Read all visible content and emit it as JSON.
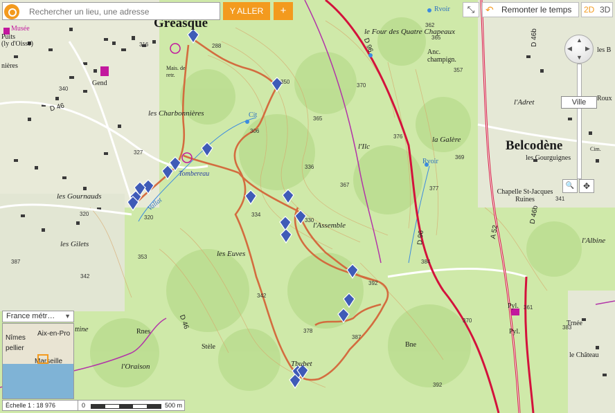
{
  "search": {
    "placeholder": "Rechercher un lieu, une adresse",
    "go_label": "Y ALLER",
    "plus_label": "+"
  },
  "toolbar": {
    "fullscreen_label": "⤡",
    "back_label": "Remonter le temps",
    "mode_2d": "2D",
    "mode_3d": "3D"
  },
  "nav": {
    "zoom_label": "Ville",
    "tool_1": "🔍",
    "tool_2": "✥"
  },
  "layer": {
    "label": "France métr…",
    "arrow": "▼"
  },
  "overview": {
    "labels": [
      "Nîmes",
      "pellier",
      "Aix-en-Pro",
      "Marseille"
    ]
  },
  "scale": {
    "ratio_label": "Échelle 1 : 18 976",
    "zero": "0",
    "max": "500 m"
  },
  "colors": {
    "accent": "#f39a1e",
    "map_green": "#cfe9a9",
    "trail": "#d4663a",
    "road": "#d3123c",
    "marker": "#3f5bb7"
  },
  "map": {
    "towns": [
      {
        "name": "Gréasque"
      },
      {
        "name": "Belcodène"
      }
    ],
    "places": [
      "les Charbonnières",
      "le Four des Quatre Chapeaux",
      "Anc. champign.",
      "l'Adret",
      "la Galère",
      "les Gourguignes",
      "Chapelle St-Jacques Ruines",
      "l'Assemble",
      "les Euves",
      "les Gournauds",
      "les Gilets",
      "Tombereau",
      "Tbubet",
      "l'Oraison",
      "l'Albine",
      "le Château",
      "Trnée",
      "Gend"
    ],
    "small": [
      "Musée",
      "Puits",
      "(ly d'Oisse)",
      "nières",
      "Vallat",
      "Stèle",
      "Rnes",
      "Bne",
      "Rvoir",
      "Rvoir",
      "Cit",
      "l'Ilc",
      "ttine",
      "Mais. de retr.",
      "Roux",
      "les B",
      "Pyl.",
      "Pyl.",
      "Cim.",
      "Ville"
    ],
    "altitudes": [
      "350",
      "365",
      "376",
      "336",
      "306",
      "367",
      "334",
      "370",
      "327",
      "330",
      "328",
      "342",
      "320",
      "353",
      "387",
      "387",
      "342",
      "383",
      "392",
      "378",
      "387",
      "392",
      "370",
      "362",
      "357",
      "365",
      "369",
      "377",
      "384",
      "361",
      "341",
      "371",
      "388",
      "371",
      "396",
      "345",
      "339",
      "355",
      "316",
      "288",
      "366",
      "320",
      "340"
    ],
    "roads": [
      "D 96",
      "D 46b",
      "D 46b",
      "D 46",
      "A 52",
      "D 96",
      "D 46b",
      "D 46d",
      "D 46"
    ]
  }
}
